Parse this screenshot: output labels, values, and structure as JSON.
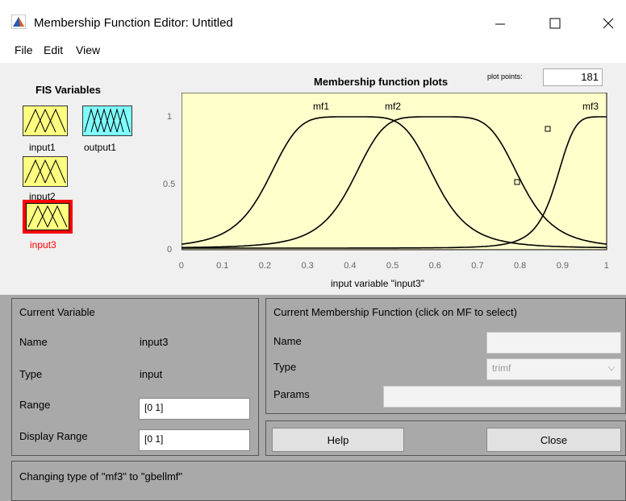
{
  "window": {
    "title": "Membership Function Editor: Untitled"
  },
  "menu": [
    "File",
    "Edit",
    "View"
  ],
  "fis": {
    "title": "FIS Variables",
    "variables": [
      {
        "label": "input1",
        "color": "#ffff80",
        "selected": false
      },
      {
        "label": "output1",
        "color": "#80ffff",
        "selected": false
      },
      {
        "label": "input2",
        "color": "#ffff80",
        "selected": false
      },
      {
        "label": "input3",
        "color": "#ffff80",
        "selected": true
      }
    ]
  },
  "plot": {
    "title": "Membership function plots",
    "plot_points_label": "plot points:",
    "plot_points_value": "181",
    "x_ticks": [
      "0",
      "0.1",
      "0.2",
      "0.3",
      "0.4",
      "0.5",
      "0.6",
      "0.7",
      "0.8",
      "0.9",
      "1"
    ],
    "y_ticks": [
      "0",
      "0.5",
      "1"
    ],
    "xlabel": "input variable \"input3\"",
    "mf_labels": [
      "mf1",
      "mf2",
      "mf3"
    ],
    "background": "#ffffcc"
  },
  "current_variable": {
    "header": "Current Variable",
    "name_label": "Name",
    "name_value": "input3",
    "type_label": "Type",
    "type_value": "input",
    "range_label": "Range",
    "range_value": "[0 1]",
    "display_range_label": "Display Range",
    "display_range_value": "[0 1]"
  },
  "current_mf": {
    "header": "Current Membership Function (click on MF to select)",
    "name_label": "Name",
    "type_label": "Type",
    "type_value": "trimf",
    "params_label": "Params"
  },
  "buttons": {
    "help": "Help",
    "close": "Close"
  },
  "status": "Changing type of \"mf3\" to \"gbellmf\"",
  "selected_color": "#ff0000"
}
